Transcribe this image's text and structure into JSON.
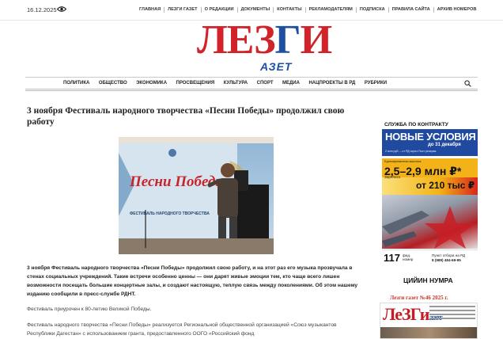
{
  "topbar": {
    "date": "16.12.2025",
    "nav": [
      "ГЛАВНАЯ",
      "ЛЕЗГИ ГАЗЕТ",
      "О РЕДАКЦИИ",
      "ДОКУМЕНТЫ",
      "КОНТАКТЫ",
      "РЕКЛАМОДАТЕЛЯМ",
      "ПОДПИСКА",
      "ПРАВИЛА САЙТА",
      "АРХИВ НОМЕРОВ"
    ]
  },
  "logo": {
    "part_a": "ЛЕЗ",
    "part_b": "Г",
    "part_c": "И",
    "sub": "АЗЕТ"
  },
  "mainnav": [
    "ПОЛИТИКА",
    "ОБЩЕСТВО",
    "ЭКОНОМИКА",
    "ПРОСВЕЩЕНИЯ",
    "КУЛЬТУРА",
    "СПОРТ",
    "МЕДИА",
    "НАЦПРОЕКТЫ В РД",
    "РУБРИКИ"
  ],
  "article": {
    "title": "3 ноября Фестиваль народного творчества «Песни Победы» продолжил свою работу",
    "photo_caption": "Песни Победы",
    "photo_sub": "ФЕСТИВАЛЬ НАРОДНОГО ТВОРЧЕСТВА",
    "p1": "3 ноября Фестиваль народного творчества «Песни Победы» продолжил свою работу, и на этот раз его музыка прозвучала в стенах социальных учреждений. Такие встречи особенно ценны — они дарят живые эмоции тем, кто чаще всего лишен возможности посещать большие концертные залы, и создают настоящую, теплую связь между поколениями. Об этом нашему изданию сообщили в пресс-службе РДНТ.",
    "p2": "Фестиваль приурочен к 80-летию Великой Победы.",
    "p3": "Фестиваль народного творчества «Песни Победы» реализуется Региональной общественной организацией «Союз музыкантов Республики Дагестан» с использованием гранта, предоставленного ООГО «Российский фонд"
  },
  "ad": {
    "head": "СЛУЖБА ПО КОНТРАКТУ",
    "title": "НОВЫЕ УСЛОВИЯ",
    "until": "до 31 декабря",
    "note": "2 млн руб. – от РД через Пост резерва",
    "l1": "Единовременная выплата",
    "big": "2,5–2,9 млн ₽*",
    "l2": "Зарплата",
    "salary": "от 210 тыс ₽",
    "phone_num": "117",
    "phone_lbl1": "фед.",
    "phone_lbl2": "номер",
    "phone_r1": "Пункт отбора на РД",
    "phone_r2": "8 (989) 484-69-95"
  },
  "sidebar": {
    "title": "ЦИЙИН НУМРА",
    "link": "Лезги газет №46 2025 г.",
    "cover_logo": "ЛеЗГи",
    "cover_sub": "азет"
  }
}
